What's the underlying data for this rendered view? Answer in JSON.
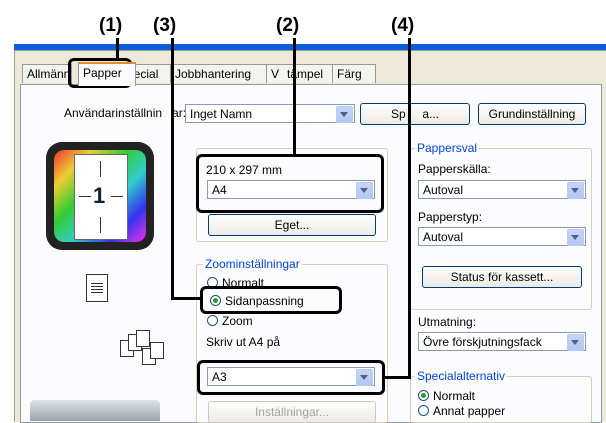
{
  "callouts": [
    "(1)",
    "(3)",
    "(2)",
    "(4)"
  ],
  "tabs": [
    "Allmänn",
    "Papper",
    "pecial",
    "Jobbhantering",
    "V",
    "tämpel",
    "Färg"
  ],
  "user_settings": {
    "label": "Användarinställnin",
    "label_suffix": "ar:",
    "value": "Inget Namn",
    "save_button": "Sp",
    "save_button_suffix": "a...",
    "default_button": "Grundinställning"
  },
  "paper_size": {
    "dimensions": "210 x 297 mm",
    "value": "A4",
    "custom_button": "Eget..."
  },
  "zoom": {
    "group_title": "Zoominställningar",
    "option_normal": "Normalt",
    "option_fit": "Sidanpassning",
    "option_zoom": "Zoom",
    "print_on_label": "Skriv ut A4 på",
    "print_on_value": "A3",
    "settings_button": "Inställningar..."
  },
  "paper_select": {
    "group_title": "Pappersval",
    "source_label": "Papperskälla:",
    "source_value": "Autoval",
    "type_label": "Papperstyp:",
    "type_value": "Autoval",
    "status_button": "Status för kassett..."
  },
  "output": {
    "label": "Utmatning:",
    "value": "Övre förskjutningsfack"
  },
  "special": {
    "group_title": "Specialalternativ",
    "option_normal": "Normalt",
    "option_other": "Annat papper"
  },
  "preview": {
    "page_number": "1"
  }
}
